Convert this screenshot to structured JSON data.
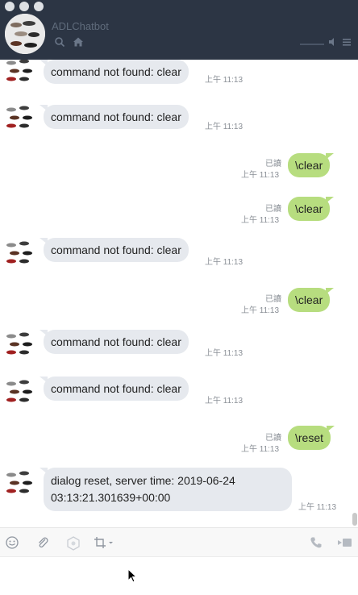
{
  "window": {
    "title": "ADLChatbot"
  },
  "messages": [
    {
      "side": "in",
      "text": "command not found: clear",
      "time": "上午 11:13"
    },
    {
      "side": "in",
      "text": "command not found: clear",
      "time": "上午 11:13"
    },
    {
      "side": "out",
      "text": "\\clear",
      "time": "上午 11:13",
      "status": "已讀"
    },
    {
      "side": "out",
      "text": "\\clear",
      "time": "上午 11:13",
      "status": "已讀"
    },
    {
      "side": "in",
      "text": "command not found: clear",
      "time": "上午 11:13"
    },
    {
      "side": "out",
      "text": "\\clear",
      "time": "上午 11:13",
      "status": "已讀"
    },
    {
      "side": "in",
      "text": "command not found: clear",
      "time": "上午 11:13"
    },
    {
      "side": "in",
      "text": "command not found: clear",
      "time": "上午 11:13"
    },
    {
      "side": "out",
      "text": "\\reset",
      "time": "上午 11:13",
      "status": "已讀"
    },
    {
      "side": "in",
      "text": "dialog reset, server time: 2019-06-24 03:13:21.301639+00:00",
      "time": "上午 11:13"
    }
  ],
  "colors": {
    "header_bg": "#2c3544",
    "bubble_in": "#e6e9ee",
    "bubble_out": "#b7dd7f"
  },
  "icons": {
    "header": [
      "search-icon",
      "home-icon",
      "volume-icon",
      "menu-icon"
    ],
    "toolbar": [
      "emoji-icon",
      "attachment-icon",
      "capture-icon",
      "crop-icon",
      "phone-icon",
      "video-icon"
    ]
  }
}
